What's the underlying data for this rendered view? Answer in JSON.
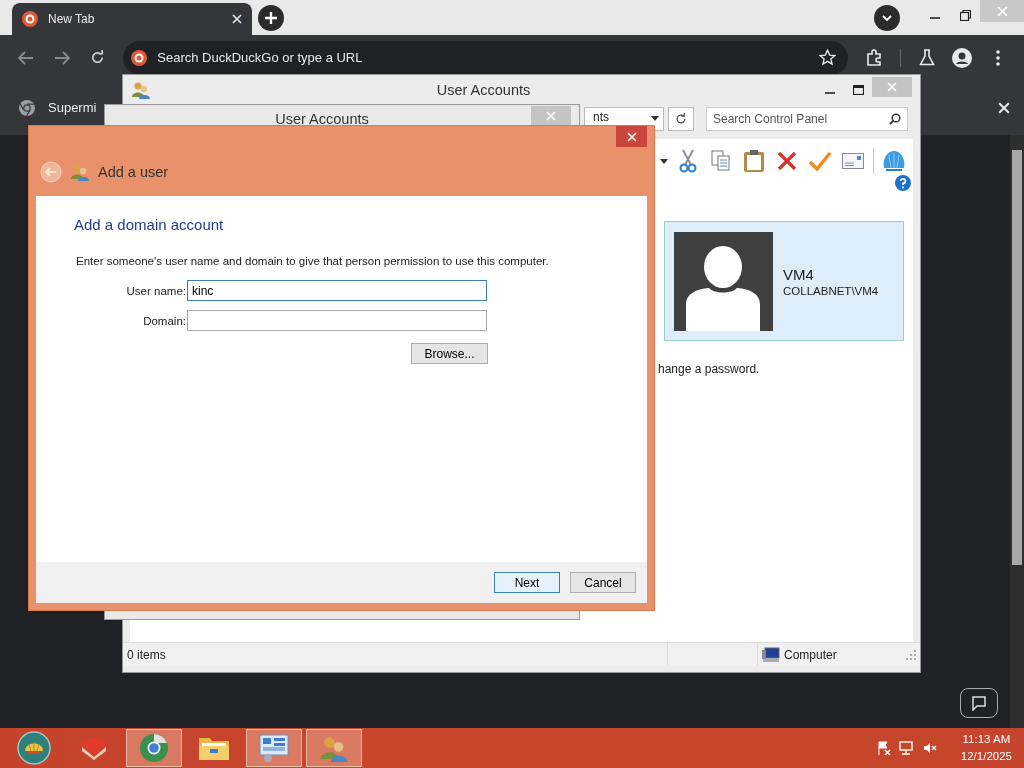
{
  "browser": {
    "tabs": [
      {
        "title": "New Tab",
        "selected": true
      }
    ],
    "omnibox": {
      "placeholder": "Search DuckDuckGo or type a URL"
    },
    "infobar": {
      "text": "Supermi"
    }
  },
  "control_panel_window": {
    "title": "User Accounts",
    "address": "nts",
    "search": {
      "placeholder": "Search Control Panel"
    },
    "account": {
      "name": "VM4",
      "detail": "COLLABNET\\VM4"
    },
    "link": "hange a password.",
    "status_bar": {
      "items": "0 items",
      "zone": "Computer"
    }
  },
  "user_accounts_window": {
    "title": "User Accounts"
  },
  "add_user_dialog": {
    "title": "Add a user",
    "heading": "Add a domain account",
    "instructions": "Enter someone's user name and domain to give that person permission to use this computer.",
    "fields": [
      {
        "label": "User name:",
        "value": "kinc",
        "focused": true
      },
      {
        "label": "Domain:",
        "focused": false
      }
    ],
    "browse_button": "Browse...",
    "buttons": [
      {
        "label": "Next",
        "default": true
      },
      {
        "label": "Cancel",
        "default": false
      }
    ]
  },
  "taskbar": {
    "items": [
      {
        "kind": "tool",
        "running": false
      },
      {
        "kind": "browser",
        "running": true
      },
      {
        "kind": "folder",
        "running": false
      },
      {
        "kind": "control-panel",
        "running": true
      },
      {
        "kind": "users",
        "running": true
      }
    ],
    "clock": {
      "time": "11:13 AM",
      "date": "12/1/2025"
    }
  }
}
